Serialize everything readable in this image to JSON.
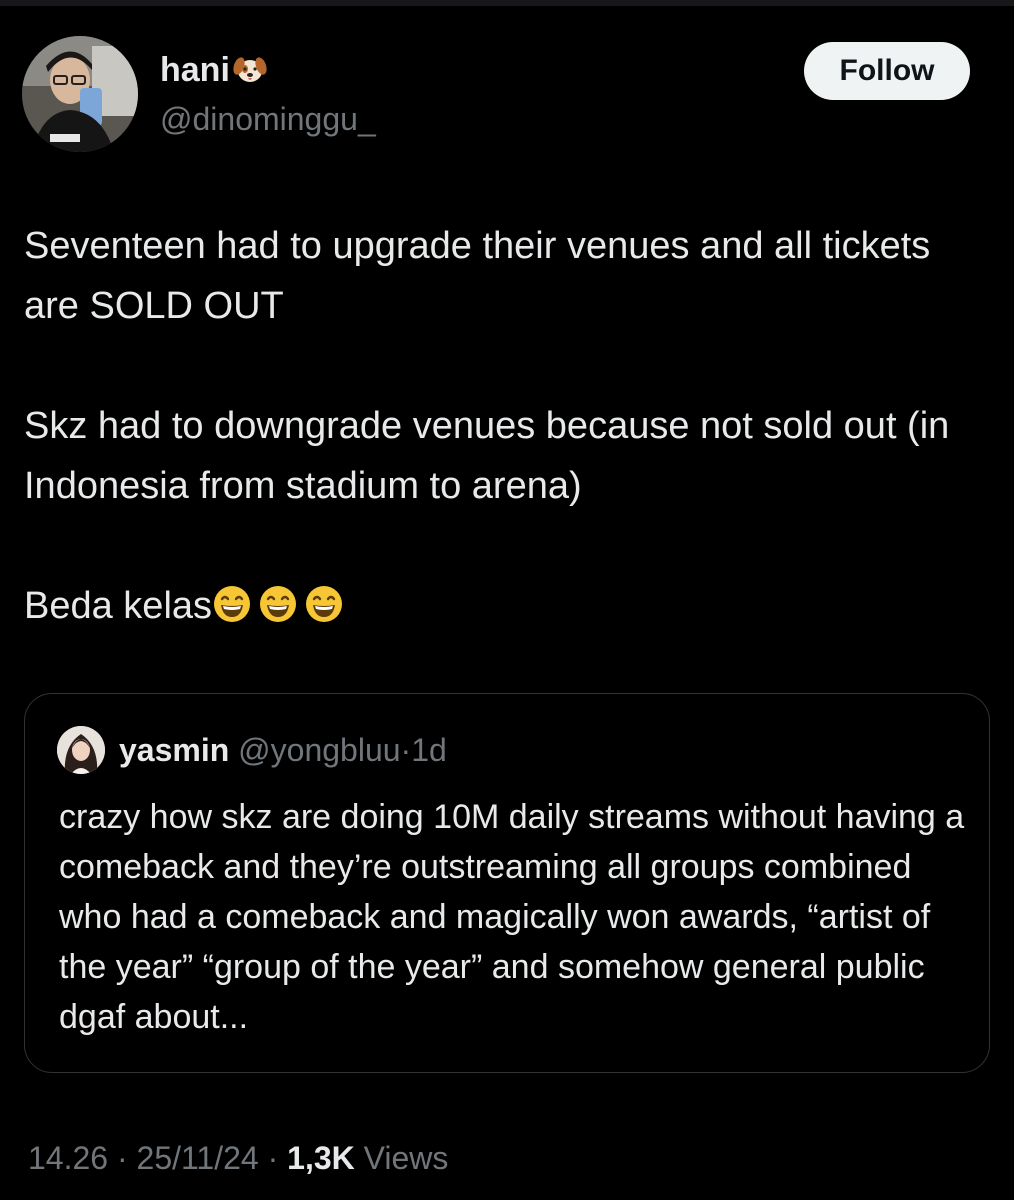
{
  "author": {
    "display_name": "hani",
    "name_emoji": "dog-face-icon",
    "handle": "@dinominggu_",
    "avatar": "avatar-photo"
  },
  "follow_label": "Follow",
  "tweet": {
    "paragraphs": [
      "Seventeen had to upgrade their venues and all tickets are SOLD OUT",
      "Skz had to downgrade venues because not sold out (in Indonesia from stadium to arena)",
      "Beda kelas"
    ],
    "trailing_emojis": [
      "grinning-face-icon",
      "grinning-face-icon",
      "grinning-face-icon"
    ]
  },
  "quote": {
    "name": "yasmin",
    "handle": "@yongbluu",
    "dot": "·",
    "time": "1d",
    "text": "crazy how skz are doing 10M daily streams without having a comeback and they’re outstreaming all groups combined who had a comeback and magically won awards, “artist of the year” “group of the year” and somehow general public dgaf about..."
  },
  "meta": {
    "time": "14.26",
    "sep1": "·",
    "date": "25/11/24",
    "sep2": "·",
    "views_count": "1,3K",
    "views_label": "Views"
  },
  "colors": {
    "background": "#000000",
    "text": "#e7e9ea",
    "muted": "#71767b",
    "border": "#2f3336",
    "follow_bg": "#eff3f4"
  }
}
